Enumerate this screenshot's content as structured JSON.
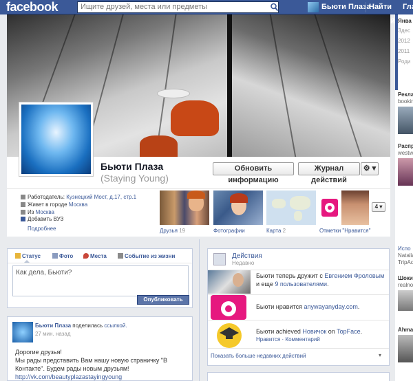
{
  "topbar": {
    "logo": "facebook",
    "search_placeholder": "Ищите друзей, места или предметы",
    "user_name": "Бьюти Плаза",
    "find_friends": "Найти друзей",
    "home": "Глав"
  },
  "profile": {
    "name": "Бьюти Плаза",
    "subname": "(Staying Young)",
    "update_info_label": "Обновить информацию",
    "activity_log_label": "Журнал действий",
    "settings_caret": "⚙ ▾"
  },
  "about": {
    "employer_prefix": "Работодатель:",
    "employer": "Кузнецкий Мост, д.17, стр.1",
    "lives_prefix": "Живет в городе",
    "lives_city": "Москва",
    "from_prefix": "Из",
    "from_city": "Москва",
    "add_school": "Добавить ВУЗ",
    "more": "Подробнее"
  },
  "tiles": [
    {
      "label": "Друзья",
      "count": "19"
    },
    {
      "label": "Фотографии",
      "count": ""
    },
    {
      "label": "Карта",
      "count": "2"
    },
    {
      "label": "Отметки \"Нравится\"",
      "count": ""
    }
  ],
  "tiles_more": "4 ▾",
  "composer": {
    "tabs": [
      "Статус",
      "Фото",
      "Места",
      "Событие из жизни"
    ],
    "placeholder": "Как дела, Бьюти?",
    "publish": "Опубликовать"
  },
  "post": {
    "author": "Бьюти Плаза",
    "action": "поделилась",
    "link_word": "ссылкой.",
    "time": "27 мин. назад",
    "line1": "Дорогие друзья!",
    "line2": "Мы рады представить Вам нашу новую страничку \"В",
    "line3": "Контакте\". Будем рады новым друзьям!",
    "url": "http://vk.com/beautyplazastayingyoung"
  },
  "actions": {
    "title": "Действия",
    "subtitle": "Недавно",
    "items": [
      {
        "prefix": "Бьюти теперь дружит с ",
        "link": "Евгением Фроловым",
        "suffix": " и еще ",
        "link2": "9 пользователями",
        "end": "."
      },
      {
        "prefix": "Бьюти нравится ",
        "link": "anywayanyday.com",
        "suffix": ".",
        "link2": "",
        "end": ""
      },
      {
        "prefix": "Бьюти achieved ",
        "link": "Новичок",
        "suffix": " on ",
        "link2": "TopFace",
        "end": "."
      }
    ],
    "item3_meta": "Нравится · Комментарий",
    "more": "Показать больше недавних действий",
    "more_caret": "▾"
  },
  "sidebar": {
    "years": [
      "Янва",
      "Здес",
      "2012",
      "2011",
      "Роди"
    ],
    "ads": [
      "Реклам",
      "booking",
      "Распрос",
      "westwi",
      "Испо",
      "Natalia",
      "TripAdv",
      "Шокир",
      "realnoe",
      "Ahmad"
    ]
  },
  "colors": {
    "brand": "#3b5998",
    "accent_pink": "#e6187f"
  }
}
